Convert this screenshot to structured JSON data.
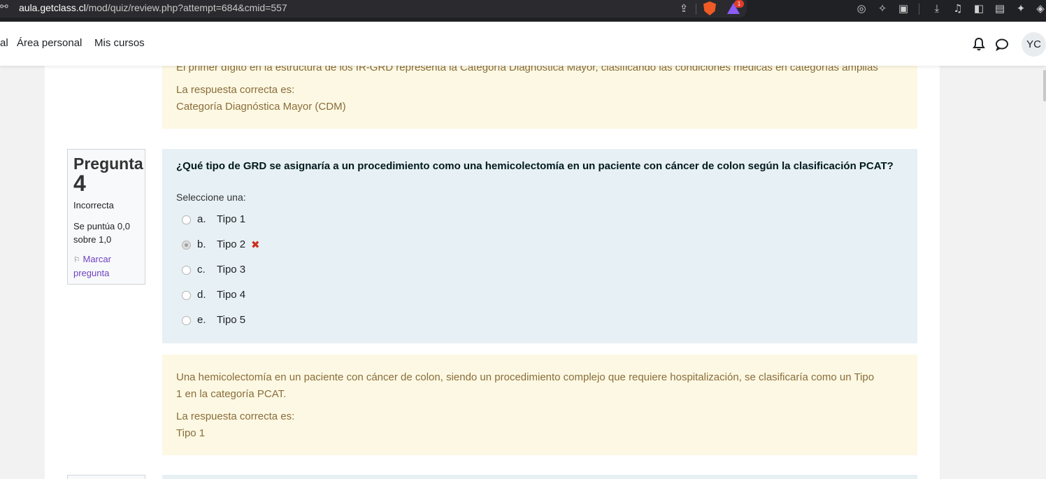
{
  "browser": {
    "url_host": "aula.getclass.cl",
    "url_path": "/mod/quiz/review.php?attempt=684&cmid=557",
    "rewards_count": "1"
  },
  "navbar": {
    "links": [
      "al",
      "Área personal",
      "Mis cursos"
    ],
    "avatar_initials": "YC"
  },
  "prev_feedback": {
    "text_partial": "El primer dígito en la estructura de los IR-GRD representa la Categoría Diagnóstica Mayor, clasificando las condiciones médicas en categorías amplias",
    "right_answer_label": "La respuesta correcta es:",
    "right_answer": "Categoría Diagnóstica Mayor (CDM)"
  },
  "question": {
    "label": "Pregunta",
    "number": "4",
    "state": "Incorrecta",
    "grade": "Se puntúa 0,0 sobre 1,0",
    "flag_label": "Marcar pregunta",
    "text": "¿Qué tipo de GRD se asignaría a un procedimiento como una hemicolectomía en un paciente con cáncer de colon según la clasificación PCAT?",
    "prompt": "Seleccione una:",
    "options": [
      {
        "letter": "a.",
        "text": "Tipo 1",
        "selected": false
      },
      {
        "letter": "b.",
        "text": "Tipo 2",
        "selected": true,
        "mark": "incorrect"
      },
      {
        "letter": "c.",
        "text": "Tipo 3",
        "selected": false
      },
      {
        "letter": "d.",
        "text": "Tipo 4",
        "selected": false
      },
      {
        "letter": "e.",
        "text": "Tipo 5",
        "selected": false
      }
    ]
  },
  "feedback": {
    "line1": "Una hemicolectomía en un paciente con cáncer de colon, siendo un procedimiento complejo que requiere hospitalización, se clasificaría como un Tipo",
    "line2": "1 en la categoría PCAT.",
    "right_answer_label": "La respuesta correcta es:",
    "right_answer": "Tipo 1"
  },
  "colors": {
    "feedback_bg": "#fcf8e3",
    "feedback_text": "#8a6d3b",
    "formulation_bg": "#e7f0f4",
    "incorrect": "#ca3120",
    "link": "#6f42c1"
  }
}
